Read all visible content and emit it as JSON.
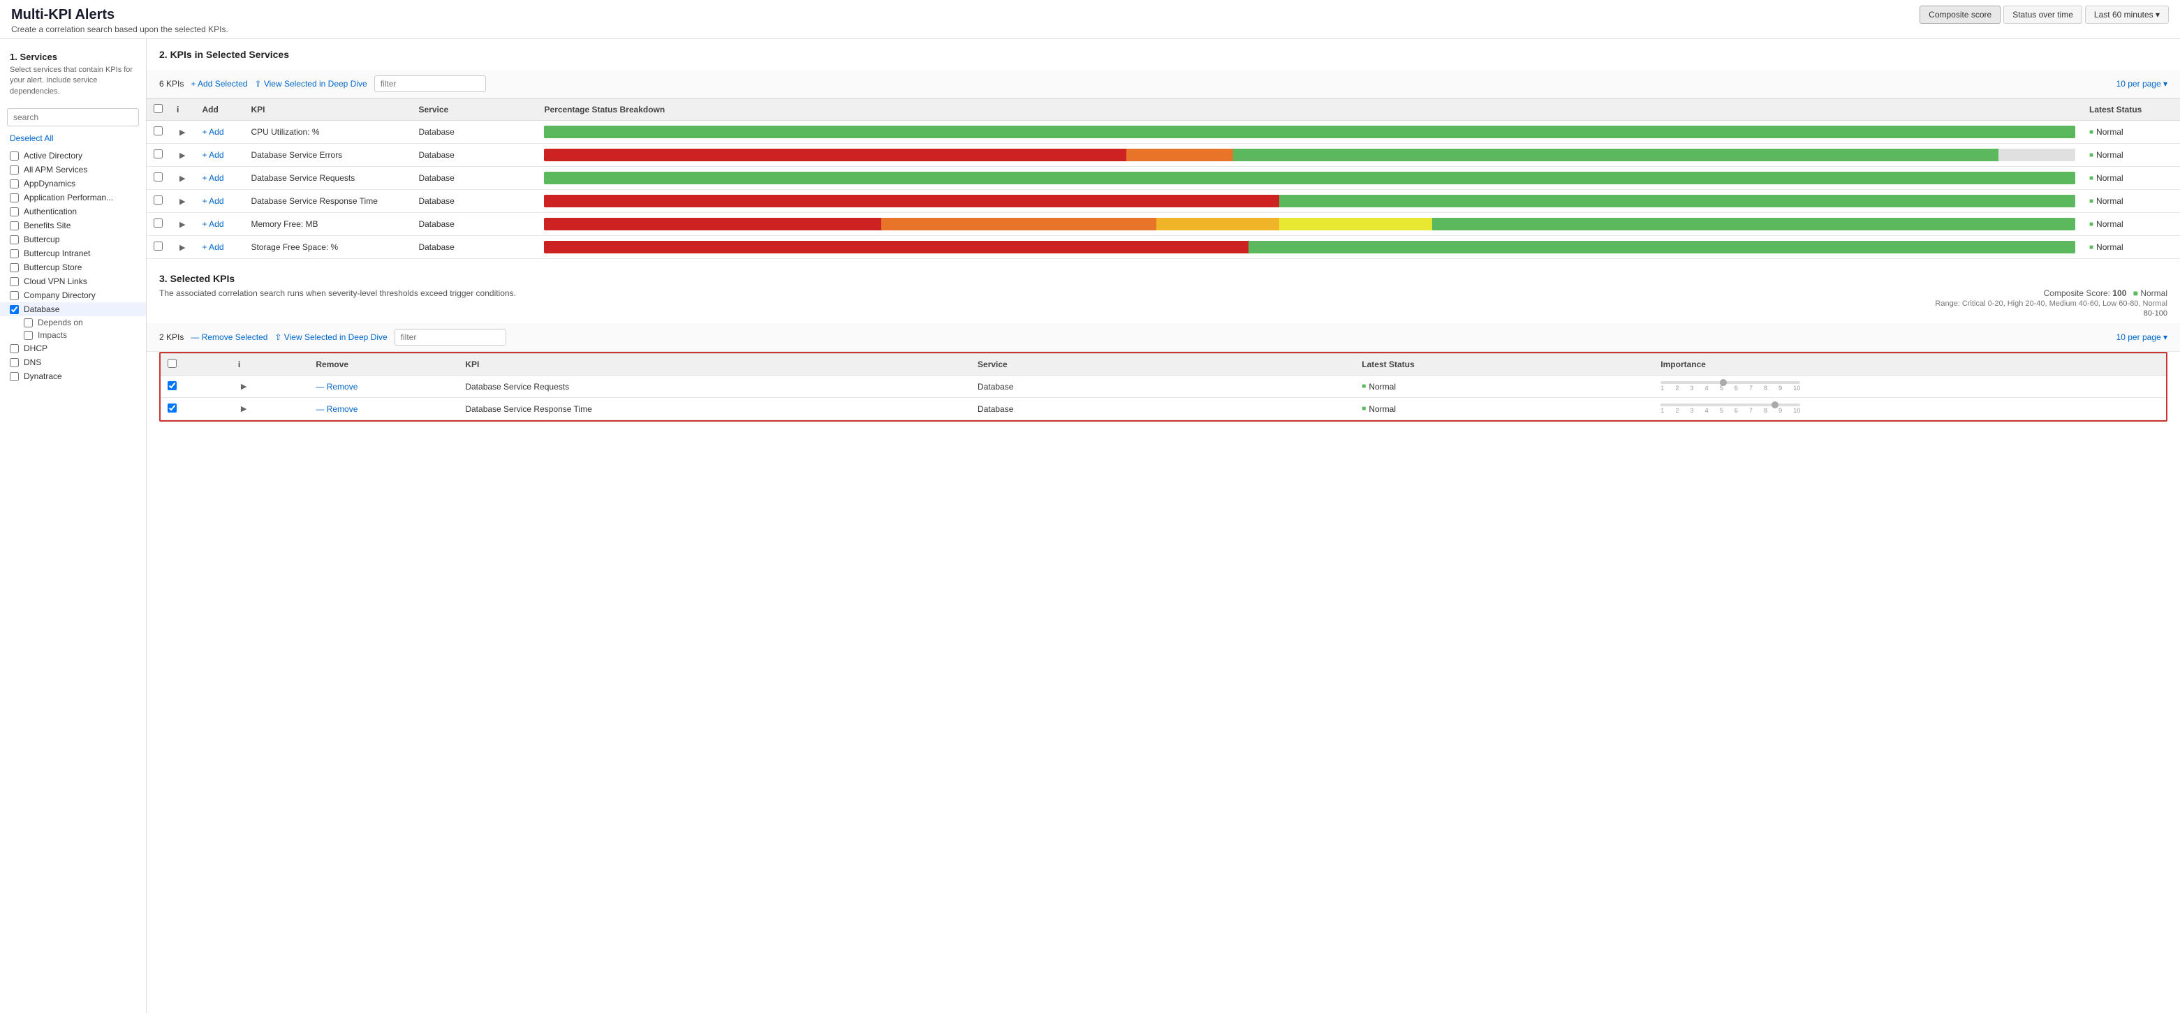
{
  "page": {
    "title": "Multi-KPI Alerts",
    "subtitle": "Create a correlation search based upon the selected KPIs."
  },
  "top_controls": {
    "composite_score": "Composite score",
    "status_over_time": "Status over time",
    "last_60": "Last 60 minutes"
  },
  "sidebar": {
    "section_title": "1. Services",
    "section_desc": "Select services that contain KPIs for your alert. Include service dependencies.",
    "search_placeholder": "search",
    "deselect_all": "Deselect All",
    "services": [
      {
        "label": "Active Directory",
        "checked": false
      },
      {
        "label": "All APM Services",
        "checked": false
      },
      {
        "label": "AppDynamics",
        "checked": false
      },
      {
        "label": "Application Performan...",
        "checked": false
      },
      {
        "label": "Authentication",
        "checked": false
      },
      {
        "label": "Benefits Site",
        "checked": false
      },
      {
        "label": "Buttercup",
        "checked": false
      },
      {
        "label": "Buttercup Intranet",
        "checked": false
      },
      {
        "label": "Buttercup Store",
        "checked": false
      },
      {
        "label": "Cloud VPN Links",
        "checked": false
      },
      {
        "label": "Company Directory",
        "checked": false
      },
      {
        "label": "Database",
        "checked": true
      },
      {
        "label": "DHCP",
        "checked": false
      },
      {
        "label": "DNS",
        "checked": false
      },
      {
        "label": "Dynatrace",
        "checked": false
      }
    ],
    "database_sub": [
      {
        "label": "Depends on",
        "checked": false
      },
      {
        "label": "Impacts",
        "checked": false
      }
    ]
  },
  "section2": {
    "title": "2. KPIs in Selected Services",
    "kpi_count": "6 KPIs",
    "add_selected": "+ Add Selected",
    "view_deep_dive": "⇧ View Selected in Deep Dive",
    "filter_placeholder": "filter",
    "per_page": "10 per page",
    "columns": [
      "",
      "i",
      "Add",
      "KPI",
      "Service",
      "Percentage Status Breakdown",
      "Latest Status"
    ],
    "rows": [
      {
        "kpi": "CPU Utilization: %",
        "service": "Database",
        "status": "Normal",
        "bar": [
          {
            "color": "#5cb85c",
            "pct": 100
          }
        ]
      },
      {
        "kpi": "Database Service Errors",
        "service": "Database",
        "status": "Normal",
        "bar": [
          {
            "color": "#cc2222",
            "pct": 38
          },
          {
            "color": "#e8742a",
            "pct": 7
          },
          {
            "color": "#5cb85c",
            "pct": 50
          },
          {
            "color": "#e0e0e0",
            "pct": 5
          }
        ]
      },
      {
        "kpi": "Database Service Requests",
        "service": "Database",
        "status": "Normal",
        "bar": [
          {
            "color": "#5cb85c",
            "pct": 100
          }
        ]
      },
      {
        "kpi": "Database Service Response Time",
        "service": "Database",
        "status": "Normal",
        "bar": [
          {
            "color": "#cc2222",
            "pct": 48
          },
          {
            "color": "#5cb85c",
            "pct": 52
          }
        ]
      },
      {
        "kpi": "Memory Free: MB",
        "service": "Database",
        "status": "Normal",
        "bar": [
          {
            "color": "#cc2222",
            "pct": 22
          },
          {
            "color": "#e8742a",
            "pct": 18
          },
          {
            "color": "#f0b429",
            "pct": 8
          },
          {
            "color": "#e8e833",
            "pct": 10
          },
          {
            "color": "#5cb85c",
            "pct": 42
          }
        ]
      },
      {
        "kpi": "Storage Free Space: %",
        "service": "Database",
        "status": "Normal",
        "bar": [
          {
            "color": "#cc2222",
            "pct": 46
          },
          {
            "color": "#5cb85c",
            "pct": 54
          }
        ]
      }
    ]
  },
  "section3": {
    "title": "3. Selected KPIs",
    "desc": "The associated correlation search runs when severity-level thresholds exceed trigger conditions.",
    "composite_score_label": "Composite Score:",
    "composite_score_value": "100",
    "composite_score_status": "Normal",
    "composite_score_range": "Range: Critical 0-20, High 20-40, Medium 40-60, Low 60-80, Normal",
    "score_range_label": "80-100",
    "kpi_count": "2 KPIs",
    "remove_selected": "— Remove Selected",
    "view_deep_dive": "⇧ View Selected in Deep Dive",
    "filter_placeholder": "filter",
    "per_page": "10 per page",
    "columns": [
      "",
      "i",
      "Remove",
      "KPI",
      "Service",
      "Latest Status",
      "Importance"
    ],
    "rows": [
      {
        "kpi": "Database Service Requests",
        "service": "Database",
        "status": "Normal",
        "checked": true,
        "slider_pos": 0.45
      },
      {
        "kpi": "Database Service Response Time",
        "service": "Database",
        "status": "Normal",
        "checked": true,
        "slider_pos": 0.82
      }
    ],
    "importance_labels": [
      "1",
      "2",
      "3",
      "4",
      "5",
      "6",
      "7",
      "8",
      "9",
      "10"
    ]
  }
}
